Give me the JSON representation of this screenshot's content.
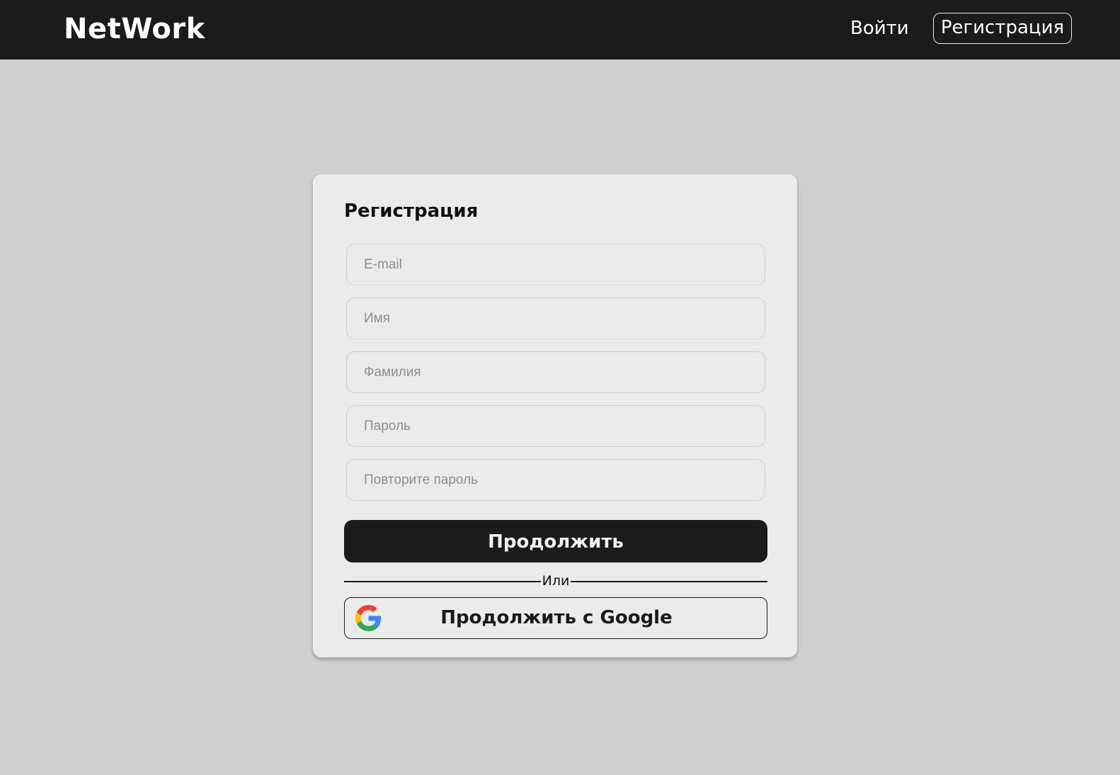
{
  "header": {
    "logo": "NetWork",
    "login_label": "Войти",
    "register_label": "Регистрация"
  },
  "form": {
    "title": "Регистрация",
    "fields": [
      {
        "placeholder": "E-mail",
        "value": ""
      },
      {
        "placeholder": "Имя",
        "value": ""
      },
      {
        "placeholder": "Фамилия",
        "value": ""
      },
      {
        "placeholder": "Пароль",
        "value": ""
      },
      {
        "placeholder": "Повторите пароль",
        "value": ""
      }
    ],
    "continue_label": "Продолжить",
    "divider_label": "Или",
    "google_label": "Продолжить с Google",
    "google_icon": "google-icon"
  },
  "colors": {
    "header_bg": "#1b1b1b",
    "page_bg": "#d0d0d0",
    "card_bg": "#ebebeb",
    "primary_button": "#1b1b1b"
  }
}
